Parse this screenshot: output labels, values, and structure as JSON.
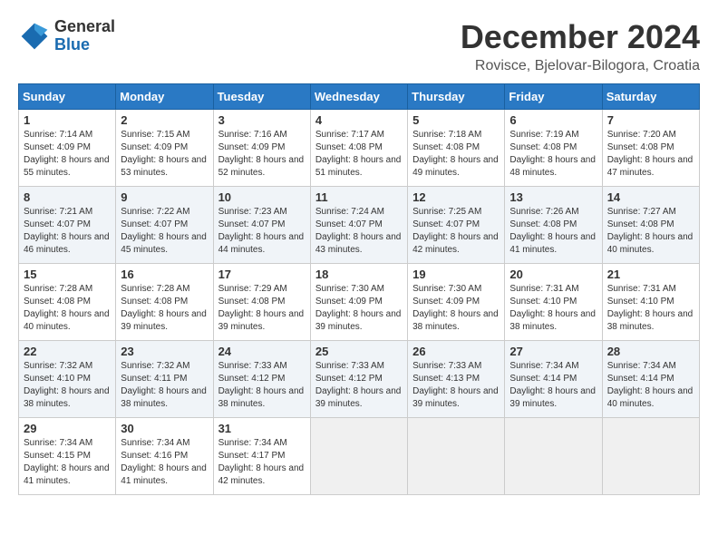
{
  "header": {
    "logo_general": "General",
    "logo_blue": "Blue",
    "month_title": "December 2024",
    "location": "Rovisce, Bjelovar-Bilogora, Croatia"
  },
  "calendar": {
    "days_of_week": [
      "Sunday",
      "Monday",
      "Tuesday",
      "Wednesday",
      "Thursday",
      "Friday",
      "Saturday"
    ],
    "weeks": [
      [
        {
          "day": 1,
          "sunrise": "7:14 AM",
          "sunset": "4:09 PM",
          "daylight": "8 hours and 55 minutes."
        },
        {
          "day": 2,
          "sunrise": "7:15 AM",
          "sunset": "4:09 PM",
          "daylight": "8 hours and 53 minutes."
        },
        {
          "day": 3,
          "sunrise": "7:16 AM",
          "sunset": "4:09 PM",
          "daylight": "8 hours and 52 minutes."
        },
        {
          "day": 4,
          "sunrise": "7:17 AM",
          "sunset": "4:08 PM",
          "daylight": "8 hours and 51 minutes."
        },
        {
          "day": 5,
          "sunrise": "7:18 AM",
          "sunset": "4:08 PM",
          "daylight": "8 hours and 49 minutes."
        },
        {
          "day": 6,
          "sunrise": "7:19 AM",
          "sunset": "4:08 PM",
          "daylight": "8 hours and 48 minutes."
        },
        {
          "day": 7,
          "sunrise": "7:20 AM",
          "sunset": "4:08 PM",
          "daylight": "8 hours and 47 minutes."
        }
      ],
      [
        {
          "day": 8,
          "sunrise": "7:21 AM",
          "sunset": "4:07 PM",
          "daylight": "8 hours and 46 minutes."
        },
        {
          "day": 9,
          "sunrise": "7:22 AM",
          "sunset": "4:07 PM",
          "daylight": "8 hours and 45 minutes."
        },
        {
          "day": 10,
          "sunrise": "7:23 AM",
          "sunset": "4:07 PM",
          "daylight": "8 hours and 44 minutes."
        },
        {
          "day": 11,
          "sunrise": "7:24 AM",
          "sunset": "4:07 PM",
          "daylight": "8 hours and 43 minutes."
        },
        {
          "day": 12,
          "sunrise": "7:25 AM",
          "sunset": "4:07 PM",
          "daylight": "8 hours and 42 minutes."
        },
        {
          "day": 13,
          "sunrise": "7:26 AM",
          "sunset": "4:08 PM",
          "daylight": "8 hours and 41 minutes."
        },
        {
          "day": 14,
          "sunrise": "7:27 AM",
          "sunset": "4:08 PM",
          "daylight": "8 hours and 40 minutes."
        }
      ],
      [
        {
          "day": 15,
          "sunrise": "7:28 AM",
          "sunset": "4:08 PM",
          "daylight": "8 hours and 40 minutes."
        },
        {
          "day": 16,
          "sunrise": "7:28 AM",
          "sunset": "4:08 PM",
          "daylight": "8 hours and 39 minutes."
        },
        {
          "day": 17,
          "sunrise": "7:29 AM",
          "sunset": "4:08 PM",
          "daylight": "8 hours and 39 minutes."
        },
        {
          "day": 18,
          "sunrise": "7:30 AM",
          "sunset": "4:09 PM",
          "daylight": "8 hours and 39 minutes."
        },
        {
          "day": 19,
          "sunrise": "7:30 AM",
          "sunset": "4:09 PM",
          "daylight": "8 hours and 38 minutes."
        },
        {
          "day": 20,
          "sunrise": "7:31 AM",
          "sunset": "4:10 PM",
          "daylight": "8 hours and 38 minutes."
        },
        {
          "day": 21,
          "sunrise": "7:31 AM",
          "sunset": "4:10 PM",
          "daylight": "8 hours and 38 minutes."
        }
      ],
      [
        {
          "day": 22,
          "sunrise": "7:32 AM",
          "sunset": "4:10 PM",
          "daylight": "8 hours and 38 minutes."
        },
        {
          "day": 23,
          "sunrise": "7:32 AM",
          "sunset": "4:11 PM",
          "daylight": "8 hours and 38 minutes."
        },
        {
          "day": 24,
          "sunrise": "7:33 AM",
          "sunset": "4:12 PM",
          "daylight": "8 hours and 38 minutes."
        },
        {
          "day": 25,
          "sunrise": "7:33 AM",
          "sunset": "4:12 PM",
          "daylight": "8 hours and 39 minutes."
        },
        {
          "day": 26,
          "sunrise": "7:33 AM",
          "sunset": "4:13 PM",
          "daylight": "8 hours and 39 minutes."
        },
        {
          "day": 27,
          "sunrise": "7:34 AM",
          "sunset": "4:14 PM",
          "daylight": "8 hours and 39 minutes."
        },
        {
          "day": 28,
          "sunrise": "7:34 AM",
          "sunset": "4:14 PM",
          "daylight": "8 hours and 40 minutes."
        }
      ],
      [
        {
          "day": 29,
          "sunrise": "7:34 AM",
          "sunset": "4:15 PM",
          "daylight": "8 hours and 41 minutes."
        },
        {
          "day": 30,
          "sunrise": "7:34 AM",
          "sunset": "4:16 PM",
          "daylight": "8 hours and 41 minutes."
        },
        {
          "day": 31,
          "sunrise": "7:34 AM",
          "sunset": "4:17 PM",
          "daylight": "8 hours and 42 minutes."
        },
        null,
        null,
        null,
        null
      ]
    ],
    "labels": {
      "sunrise": "Sunrise:",
      "sunset": "Sunset:",
      "daylight": "Daylight:"
    }
  }
}
